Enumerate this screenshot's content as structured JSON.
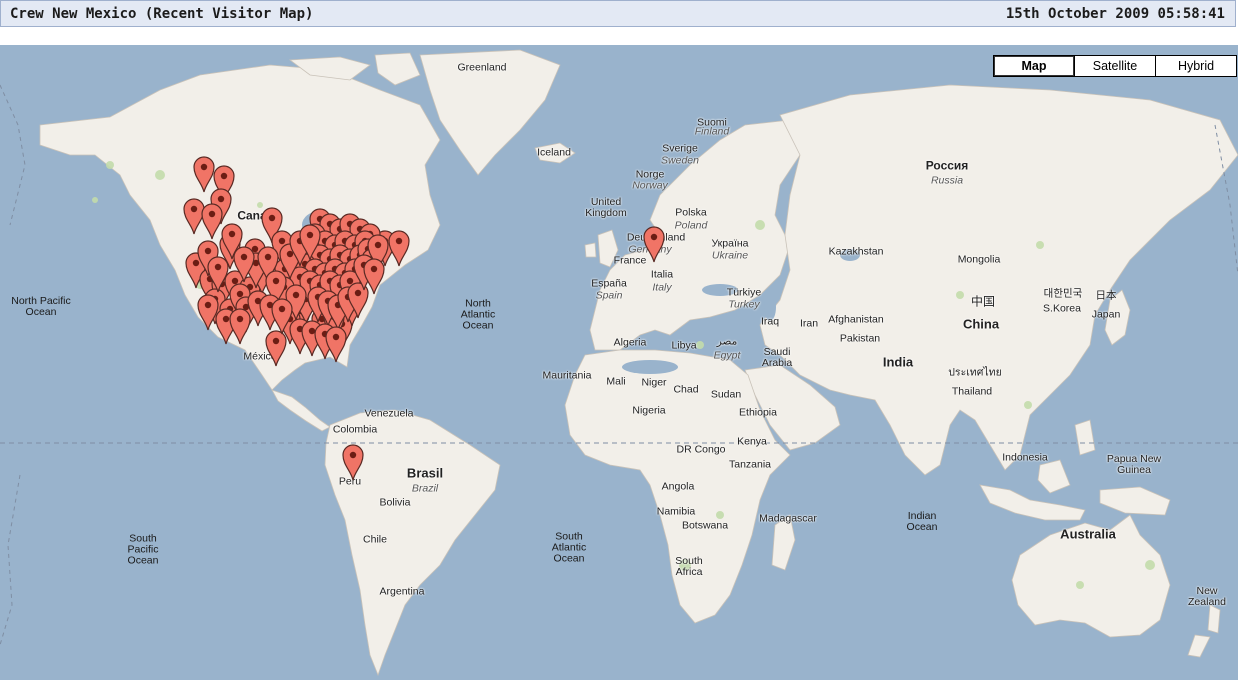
{
  "header": {
    "title": "Crew New Mexico (Recent Visitor Map)",
    "datetime": "15th October 2009 05:58:41"
  },
  "map_types": [
    {
      "label": "Map",
      "active": true
    },
    {
      "label": "Satellite",
      "active": false
    },
    {
      "label": "Hybrid",
      "active": false
    }
  ],
  "colors": {
    "ocean": "#99b3cc",
    "land": "#f2efe9",
    "park": "#c3dcab",
    "marker": "#f07466",
    "title_bar": "#e3e9f4"
  },
  "marker_icon": "map-marker-icon",
  "marker_count": 96,
  "map_labels": {
    "greenland": "Greenland",
    "iceland": "Iceland",
    "canada": "Canada",
    "north_pacific_ocean": "North Pacific\nOcean",
    "north_atlantic_ocean": "North\nAtlantic\nOcean",
    "mexico": "México",
    "suomi": "Suomi",
    "finland": "Finland",
    "sverige": "Sverige",
    "sweden": "Sweden",
    "norge": "Norge",
    "norway": "Norway",
    "united_kingdom": "United\nKingdom",
    "polska": "Polska",
    "poland": "Poland",
    "deutschland": "Deutschland",
    "germany": "Germany",
    "ukraina": "Україна",
    "ukraine": "Ukraine",
    "france": "France",
    "italia": "Italia",
    "italy": "Italy",
    "espana": "España",
    "spain": "Spain",
    "turkiye": "Türkiye",
    "turkey": "Turkey",
    "rossiya": "Россия",
    "russia": "Russia",
    "kazakhstan": "Kazakhstan",
    "mongolia": "Mongolia",
    "china_native": "中国",
    "china": "China",
    "korea_native": "대한민국",
    "s_korea": "S.Korea",
    "japan_native": "日本",
    "japan": "Japan",
    "iraq": "Iraq",
    "iran": "Iran",
    "afghanistan": "Afghanistan",
    "pakistan": "Pakistan",
    "india": "India",
    "thailand_native": "ประเทศไทย",
    "thailand": "Thailand",
    "algeria": "Algeria",
    "libya": "Libya",
    "egypt_native": "مصر",
    "egypt": "Egypt",
    "saudi_arabia": "Saudi\nArabia",
    "mauritania": "Mauritania",
    "mali": "Mali",
    "niger": "Niger",
    "chad": "Chad",
    "sudan": "Sudan",
    "nigeria": "Nigeria",
    "ethiopia": "Ethiopia",
    "kenya": "Kenya",
    "dr_congo": "DR Congo",
    "tanzania": "Tanzania",
    "angola": "Angola",
    "namibia": "Namibia",
    "botswana": "Botswana",
    "madagascar": "Madagascar",
    "south_africa": "South\nAfrica",
    "venezuela": "Venezuela",
    "colombia": "Colombia",
    "peru": "Peru",
    "brasil": "Brasil",
    "brazil": "Brazil",
    "bolivia": "Bolivia",
    "chile": "Chile",
    "argentina": "Argentina",
    "south_pacific_ocean": "South\nPacific\nOcean",
    "south_atlantic_ocean": "South\nAtlantic\nOcean",
    "indian_ocean": "Indian\nOcean",
    "indonesia": "Indonesia",
    "papua_new_guinea": "Papua New\nGuinea",
    "australia": "Australia",
    "new_zealand": "New\nZealand"
  }
}
